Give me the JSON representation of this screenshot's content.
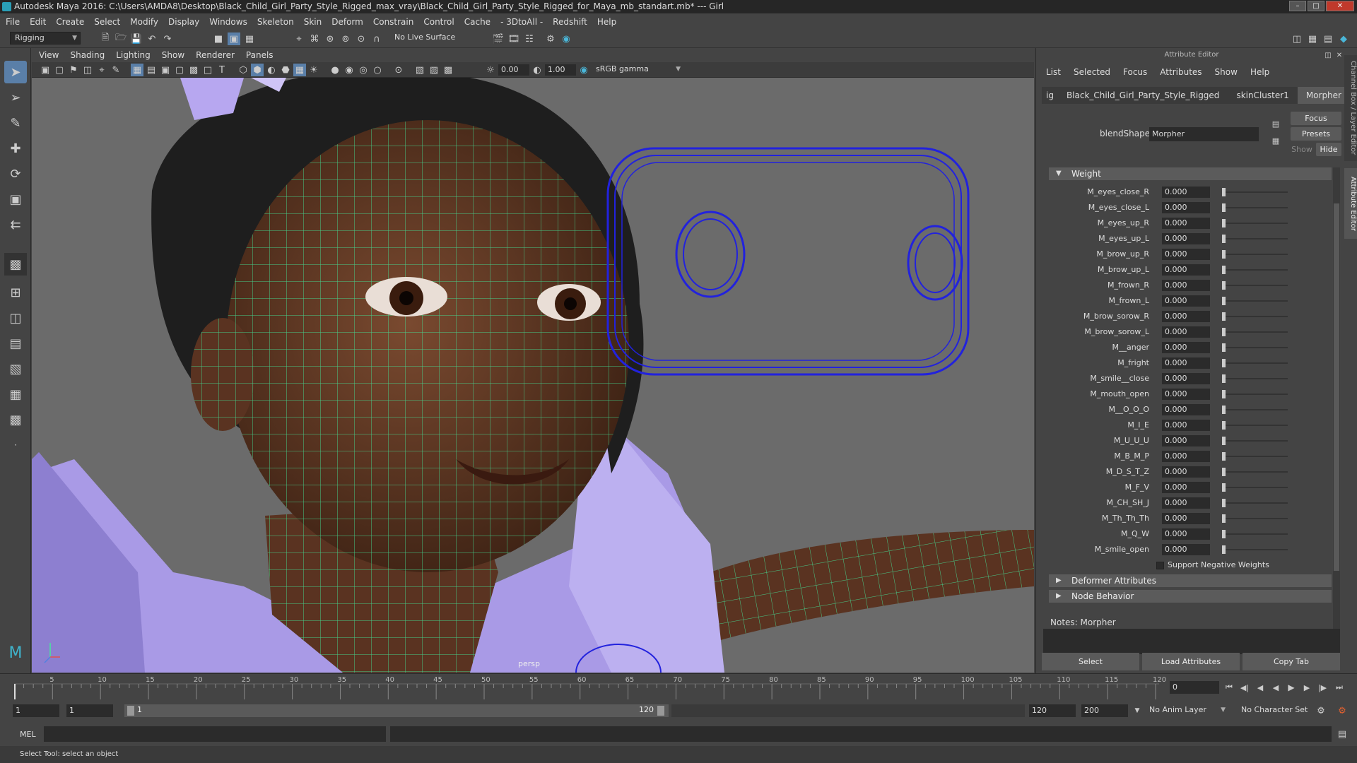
{
  "window": {
    "title": "Autodesk Maya 2016: C:\\Users\\AMDA8\\Desktop\\Black_Child_Girl_Party_Style_Rigged_max_vray\\Black_Child_Girl_Party_Style_Rigged_for_Maya_mb_standart.mb*  ---  Girl"
  },
  "menubar": [
    "File",
    "Edit",
    "Create",
    "Select",
    "Modify",
    "Display",
    "Windows",
    "Skeleton",
    "Skin",
    "Deform",
    "Constrain",
    "Control",
    "Cache",
    "- 3DtoAll -",
    "Redshift",
    "Help"
  ],
  "shelf": {
    "mode": "Rigging",
    "live_surface": "No Live Surface"
  },
  "panel_menu": [
    "View",
    "Shading",
    "Lighting",
    "Show",
    "Renderer",
    "Panels"
  ],
  "panel_tools": {
    "near_value": "0.00",
    "far_value": "1.00",
    "color_space": "sRGB gamma"
  },
  "viewport": {
    "camera_label": "persp"
  },
  "attribute_editor": {
    "title": "Attribute Editor",
    "menu": [
      "List",
      "Selected",
      "Focus",
      "Attributes",
      "Show",
      "Help"
    ],
    "tabs": [
      "ig",
      "Black_Child_Girl_Party_Style_Rigged",
      "skinCluster1",
      "Morpher"
    ],
    "active_tab": "Morpher",
    "focus_btn": "Focus",
    "presets_btn": "Presets",
    "show_btn": "Show",
    "hide_btn": "Hide",
    "blendshape_label": "blendShape:",
    "blendshape_value": "Morpher",
    "weight_section": "Weight",
    "weights": [
      {
        "name": "M_eyes_close_R",
        "value": "0.000"
      },
      {
        "name": "M_eyes_close_L",
        "value": "0.000"
      },
      {
        "name": "M_eyes_up_R",
        "value": "0.000"
      },
      {
        "name": "M_eyes_up_L",
        "value": "0.000"
      },
      {
        "name": "M_brow_up_R",
        "value": "0.000"
      },
      {
        "name": "M_brow_up_L",
        "value": "0.000"
      },
      {
        "name": "M_frown_R",
        "value": "0.000"
      },
      {
        "name": "M_frown_L",
        "value": "0.000"
      },
      {
        "name": "M_brow_sorow_R",
        "value": "0.000"
      },
      {
        "name": "M_brow_sorow_L",
        "value": "0.000"
      },
      {
        "name": "M__anger",
        "value": "0.000"
      },
      {
        "name": "M_fright",
        "value": "0.000"
      },
      {
        "name": "M_smile__close",
        "value": "0.000"
      },
      {
        "name": "M_mouth_open",
        "value": "0.000"
      },
      {
        "name": "M__O_O_O",
        "value": "0.000"
      },
      {
        "name": "M_I_E",
        "value": "0.000"
      },
      {
        "name": "M_U_U_U",
        "value": "0.000"
      },
      {
        "name": "M_B_M_P",
        "value": "0.000"
      },
      {
        "name": "M_D_S_T_Z",
        "value": "0.000"
      },
      {
        "name": "M_F_V",
        "value": "0.000"
      },
      {
        "name": "M_CH_SH_J",
        "value": "0.000"
      },
      {
        "name": "M_Th_Th_Th",
        "value": "0.000"
      },
      {
        "name": "M_Q_W",
        "value": "0.000"
      },
      {
        "name": "M_smile_open",
        "value": "0.000"
      }
    ],
    "support_negative": "Support Negative Weights",
    "deformer_section": "Deformer Attributes",
    "node_section": "Node Behavior",
    "notes_label": "Notes:  Morpher",
    "bottom_buttons": [
      "Select",
      "Load Attributes",
      "Copy Tab"
    ],
    "side_tabs": [
      "Channel Box / Layer Editor",
      "Attribute Editor"
    ]
  },
  "timeline": {
    "ticks": [
      "5",
      "10",
      "15",
      "20",
      "25",
      "30",
      "35",
      "40",
      "45",
      "50",
      "55",
      "60",
      "65",
      "70",
      "75",
      "80",
      "85",
      "90",
      "95",
      "100",
      "105",
      "110",
      "115",
      "120"
    ],
    "current_frame": "0"
  },
  "range": {
    "start": "1",
    "playback_start": "1",
    "slider_start": "1",
    "slider_end": "120",
    "playback_end": "120",
    "end": "200",
    "anim_layer": "No Anim Layer",
    "character_set": "No Character Set"
  },
  "command": {
    "lang": "MEL"
  },
  "help_line": "Select Tool: select an object",
  "colors": {
    "wireframe": "#43e89a",
    "control_curve": "#2222dd",
    "dress": "#a99ae6",
    "skin": "#5a3321",
    "hair": "#1e1e1e"
  }
}
